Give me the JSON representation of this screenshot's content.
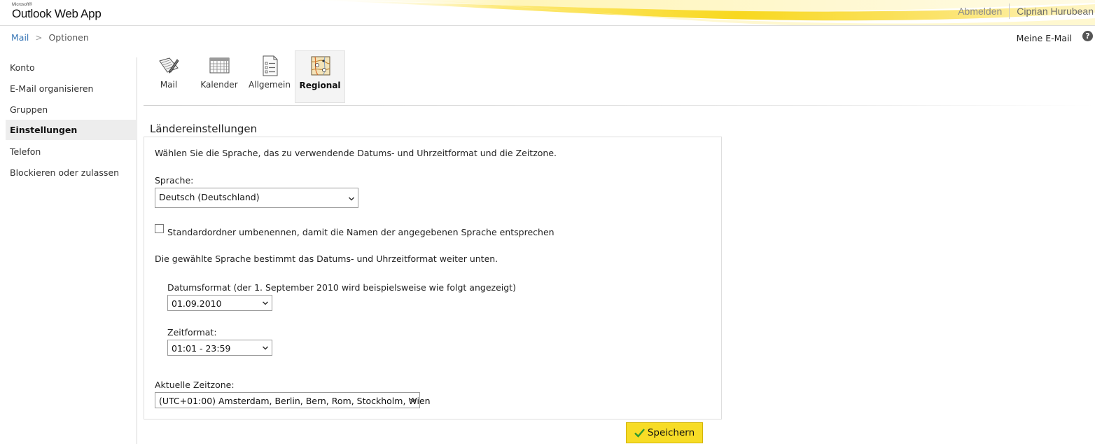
{
  "header": {
    "brand_small": "Microsoft®",
    "brand": "Outlook Web App",
    "signout": "Abmelden",
    "user": "Ciprian Hurubean",
    "accent": "#f7dc26"
  },
  "breadcrumb": {
    "root": "Mail",
    "separator": ">",
    "current": "Optionen"
  },
  "mymail": "Meine E-Mail",
  "help": "?",
  "nav": {
    "items": [
      {
        "label": "Konto",
        "active": false
      },
      {
        "label": "E-Mail organisieren",
        "active": false
      },
      {
        "label": "Gruppen",
        "active": false
      },
      {
        "label": "Einstellungen",
        "active": true
      },
      {
        "label": "Telefon",
        "active": false
      },
      {
        "label": "Blockieren oder zulassen",
        "active": false
      }
    ]
  },
  "tabs": [
    {
      "label": "Mail",
      "icon": "mail-settings-icon",
      "active": false
    },
    {
      "label": "Kalender",
      "icon": "calendar-icon",
      "active": false
    },
    {
      "label": "Allgemein",
      "icon": "general-list-icon",
      "active": false
    },
    {
      "label": "Regional",
      "icon": "regional-map-icon",
      "active": true
    }
  ],
  "section": {
    "title": "Ländereinstellungen",
    "intro": "Wählen Sie die Sprache, das zu verwendende Datums- und Uhrzeitformat und die Zeitzone.",
    "language_label": "Sprache:",
    "language_value": "Deutsch (Deutschland)",
    "rename_folders_label": "Standardordner umbenennen, damit die Namen der angegebenen Sprache entsprechen",
    "rename_folders_checked": false,
    "format_note": "Die gewählte Sprache bestimmt das Datums- und Uhrzeitformat weiter unten.",
    "date_format_label": "Datumsformat (der 1. September 2010 wird beispielsweise wie folgt angezeigt)",
    "date_format_value": "01.09.2010",
    "time_format_label": "Zeitformat:",
    "time_format_value": "01:01 - 23:59",
    "timezone_label": "Aktuelle Zeitzone:",
    "timezone_value": "(UTC+01:00) Amsterdam, Berlin, Bern, Rom, Stockholm, Wien"
  },
  "save_label": "Speichern"
}
